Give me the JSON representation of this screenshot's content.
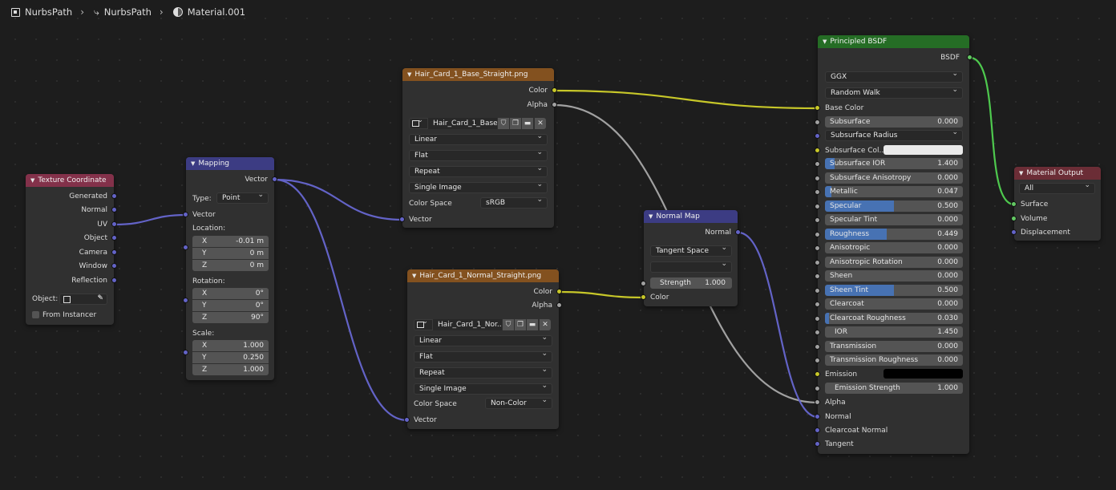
{
  "breadcrumb": {
    "object": "NurbsPath",
    "data": "NurbsPath",
    "material": "Material.001"
  },
  "colors": {
    "vector_socket": "#6363c7",
    "color_socket": "#c7c729",
    "float_socket": "#a1a1a1",
    "shader_socket": "#63c763",
    "vector_link": "#6363c7",
    "color_link": "#c7c729",
    "float_link": "#a1a1a1",
    "shader_link": "#4ec94e",
    "header_input": "#83314a",
    "header_vector": "#3c3c83",
    "header_texture": "#83511f",
    "header_shader": "#256d25",
    "header_output": "#6b2d36",
    "slider_fill": "#4772b3"
  },
  "texcoord": {
    "title": "Texture Coordinate",
    "outputs": [
      "Generated",
      "Normal",
      "UV",
      "Object",
      "Camera",
      "Window",
      "Reflection"
    ],
    "object_label": "Object:",
    "from_instancer": "From Instancer"
  },
  "mapping": {
    "title": "Mapping",
    "output": "Vector",
    "type_label": "Type:",
    "type_value": "Point",
    "input_vector": "Vector",
    "location_label": "Location:",
    "rotation_label": "Rotation:",
    "scale_label": "Scale:",
    "location": [
      {
        "axis": "X",
        "value": "-0.01 m"
      },
      {
        "axis": "Y",
        "value": "0 m"
      },
      {
        "axis": "Z",
        "value": "0 m"
      }
    ],
    "rotation": [
      {
        "axis": "X",
        "value": "0°"
      },
      {
        "axis": "Y",
        "value": "0°"
      },
      {
        "axis": "Z",
        "value": "90°"
      }
    ],
    "scale": [
      {
        "axis": "X",
        "value": "1.000"
      },
      {
        "axis": "Y",
        "value": "0.250"
      },
      {
        "axis": "Z",
        "value": "1.000"
      }
    ]
  },
  "tex_base": {
    "title": "Hair_Card_1_Base_Straight.png",
    "out_color": "Color",
    "out_alpha": "Alpha",
    "image_name": "Hair_Card_1_Base...",
    "interpolation": "Linear",
    "projection": "Flat",
    "extension": "Repeat",
    "source": "Single Image",
    "color_space_label": "Color Space",
    "color_space": "sRGB",
    "in_vector": "Vector"
  },
  "tex_normal": {
    "title": "Hair_Card_1_Normal_Straight.png",
    "out_color": "Color",
    "out_alpha": "Alpha",
    "image_name": "Hair_Card_1_Nor...",
    "interpolation": "Linear",
    "projection": "Flat",
    "extension": "Repeat",
    "source": "Single Image",
    "color_space_label": "Color Space",
    "color_space": "Non-Color",
    "in_vector": "Vector"
  },
  "normal_map": {
    "title": "Normal Map",
    "output": "Normal",
    "space": "Tangent Space",
    "strength_label": "Strength",
    "strength": "1.000",
    "fill": 1.0,
    "in_color": "Color"
  },
  "bsdf": {
    "title": "Principled BSDF",
    "output": "BSDF",
    "distribution": "GGX",
    "subsurface_method": "Random Walk",
    "base_color": "Base Color",
    "subsurface": {
      "label": "Subsurface",
      "value": "0.000",
      "fill": 0
    },
    "subsurface_radius": "Subsurface Radius",
    "subsurface_color": "Subsurface Col...",
    "sliders": [
      {
        "label": "Subsurface IOR",
        "value": "1.400",
        "fill": 0.07
      },
      {
        "label": "Subsurface Anisotropy",
        "value": "0.000",
        "fill": 0
      },
      {
        "label": "Metallic",
        "value": "0.047",
        "fill": 0.047
      },
      {
        "label": "Specular",
        "value": "0.500",
        "fill": 0.5
      },
      {
        "label": "Specular Tint",
        "value": "0.000",
        "fill": 0
      },
      {
        "label": "Roughness",
        "value": "0.449",
        "fill": 0.449
      },
      {
        "label": "Anisotropic",
        "value": "0.000",
        "fill": 0
      },
      {
        "label": "Anisotropic Rotation",
        "value": "0.000",
        "fill": 0
      },
      {
        "label": "Sheen",
        "value": "0.000",
        "fill": 0
      },
      {
        "label": "Sheen Tint",
        "value": "0.500",
        "fill": 0.5
      },
      {
        "label": "Clearcoat",
        "value": "0.000",
        "fill": 0
      },
      {
        "label": "Clearcoat Roughness",
        "value": "0.030",
        "fill": 0.03
      },
      {
        "label": "IOR",
        "value": "1.450",
        "fill": 0
      },
      {
        "label": "Transmission",
        "value": "0.000",
        "fill": 0
      },
      {
        "label": "Transmission Roughness",
        "value": "0.000",
        "fill": 0
      }
    ],
    "emission": "Emission",
    "emission_strength": {
      "label": "Emission Strength",
      "value": "1.000"
    },
    "alpha": "Alpha",
    "normal": "Normal",
    "clearcoat_normal": "Clearcoat Normal",
    "tangent": "Tangent"
  },
  "material_output": {
    "title": "Material Output",
    "target": "All",
    "inputs": [
      "Surface",
      "Volume",
      "Displacement"
    ]
  }
}
